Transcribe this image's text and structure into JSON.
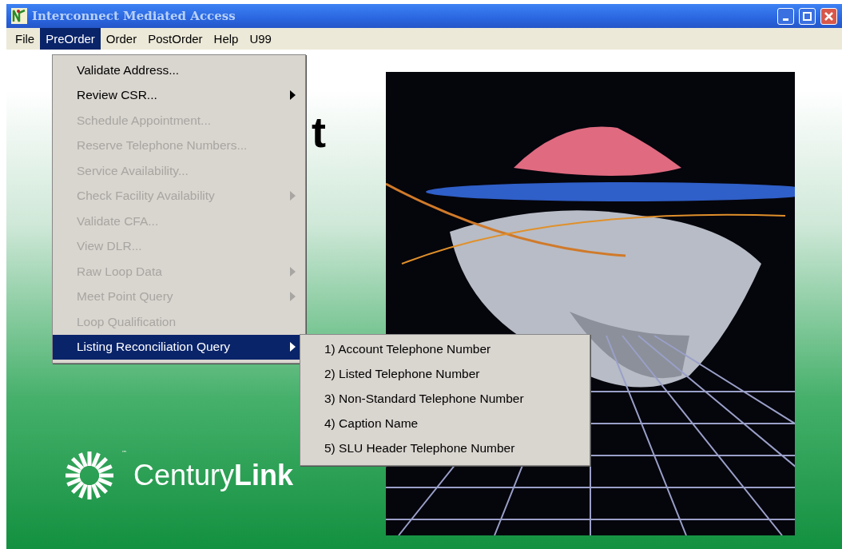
{
  "window": {
    "title": "Interconnect Mediated Access"
  },
  "menu_bar": [
    {
      "label": "File",
      "selected": false
    },
    {
      "label": "PreOrder",
      "selected": true
    },
    {
      "label": "Order",
      "selected": false
    },
    {
      "label": "PostOrder",
      "selected": false
    },
    {
      "label": "Help",
      "selected": false
    },
    {
      "label": "U99",
      "selected": false
    }
  ],
  "menu": [
    {
      "label": "Validate Address...",
      "disabled": false,
      "submenu": false,
      "selected": false
    },
    {
      "label": "Review CSR...",
      "disabled": false,
      "submenu": true,
      "selected": false
    },
    {
      "label": "Schedule Appointment...",
      "disabled": true,
      "submenu": false,
      "selected": false
    },
    {
      "label": "Reserve Telephone Numbers...",
      "disabled": true,
      "submenu": false,
      "selected": false
    },
    {
      "label": "Service Availability...",
      "disabled": true,
      "submenu": false,
      "selected": false
    },
    {
      "label": "Check Facility Availability",
      "disabled": true,
      "submenu": true,
      "selected": false
    },
    {
      "label": "Validate CFA...",
      "disabled": true,
      "submenu": false,
      "selected": false
    },
    {
      "label": "View DLR...",
      "disabled": true,
      "submenu": false,
      "selected": false
    },
    {
      "label": "Raw Loop Data",
      "disabled": true,
      "submenu": true,
      "selected": false
    },
    {
      "label": "Meet Point Query",
      "disabled": true,
      "submenu": true,
      "selected": false
    },
    {
      "label": "Loop Qualification",
      "disabled": true,
      "submenu": false,
      "selected": false
    },
    {
      "label": "Listing Reconciliation Query",
      "disabled": false,
      "submenu": true,
      "selected": true
    }
  ],
  "submenu": [
    {
      "label": "1) Account Telephone Number"
    },
    {
      "label": "2) Listed Telephone Number"
    },
    {
      "label": "3) Non-Standard Telephone Number"
    },
    {
      "label": "4) Caption Name"
    },
    {
      "label": "5) SLU Header Telephone Number"
    }
  ],
  "heading_fragment": "t",
  "logo": {
    "text": "Century**Link**",
    "mark_tm": "™"
  }
}
